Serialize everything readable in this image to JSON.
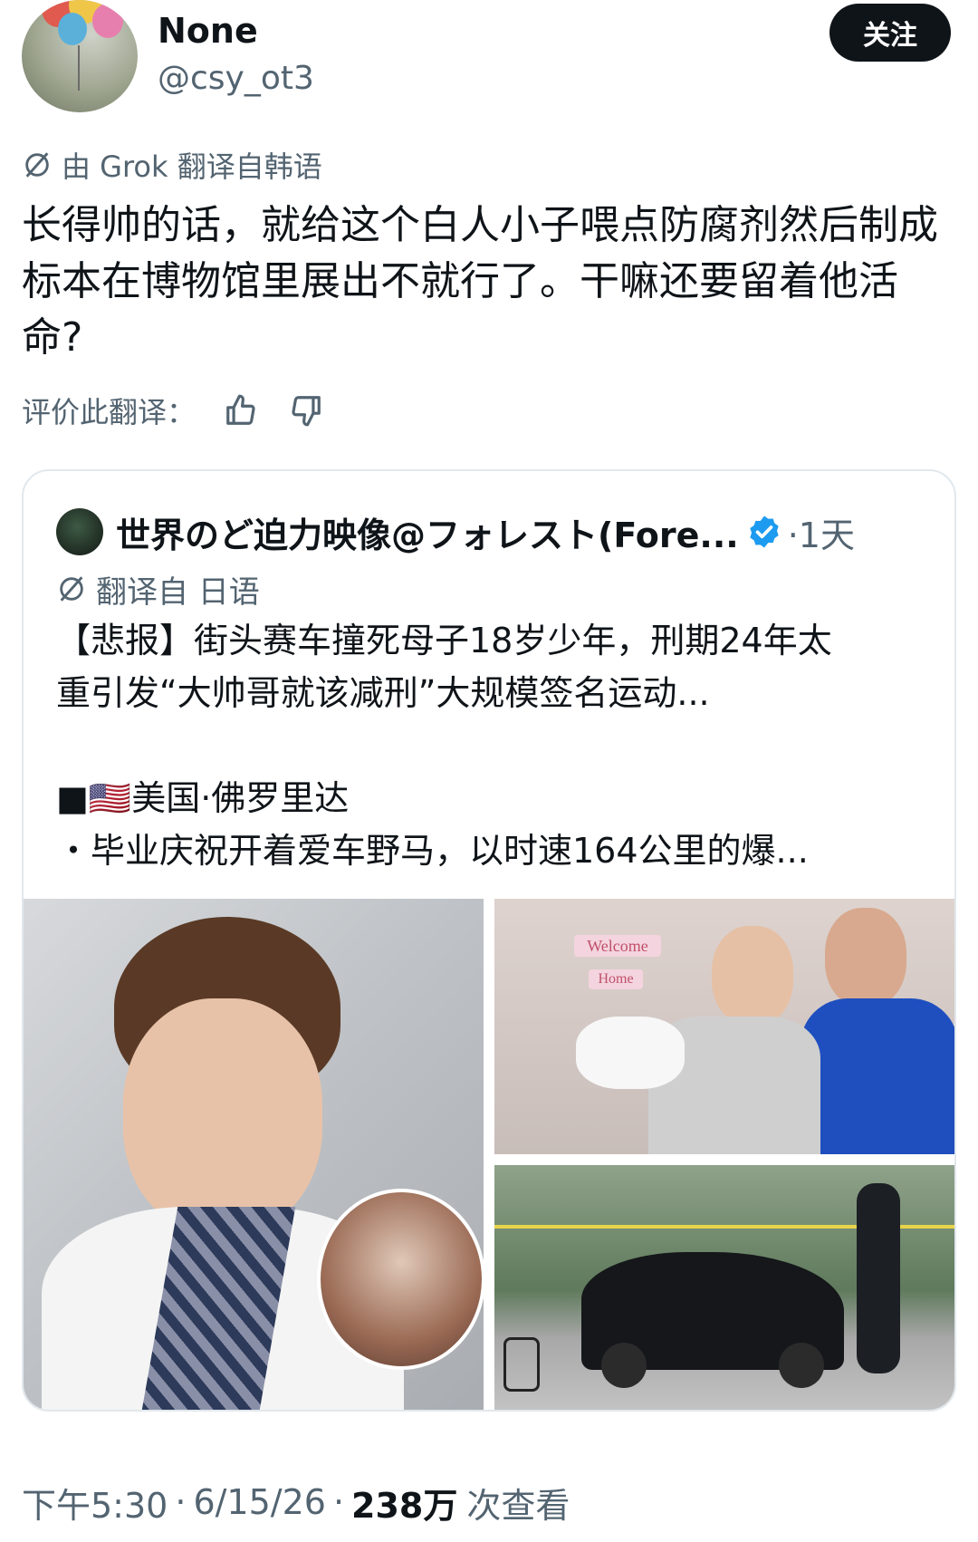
{
  "author": {
    "name": "None",
    "handle": "@csy_ot3"
  },
  "follow_label": "关注",
  "translation_note": "由 Grok 翻译自韩语",
  "post_text": "长得帅的话，就给这个白人小子喂点防腐剂然后制成标本在博物馆里展出不就行了。干嘛还要留着他活命?",
  "rate_label": "评价此翻译：",
  "quoted": {
    "name": "世界のど迫力映像@フォレスト(Fore...",
    "time": "·1天",
    "translation_note": "翻译自 日语",
    "lines": [
      "【悲报】街头赛车撞死母子18岁少年，刑期24年太",
      "重引发“大帅哥就该减刑”大规模签名运动...",
      "",
      "■🇺🇸美国·佛罗里达",
      "・毕业庆祝开着爱车野马，以时速164公里的爆..."
    ],
    "media_text": {
      "welcome": "Welcome",
      "home": "Home"
    }
  },
  "footer": {
    "time": "下午5:30",
    "date": "6/15/26",
    "views": "238万",
    "views_label": "次查看"
  },
  "colors": {
    "text": "#0f1419",
    "secondary": "#536471",
    "verified": "#1d9bf0",
    "border": "#e1e8ed"
  }
}
